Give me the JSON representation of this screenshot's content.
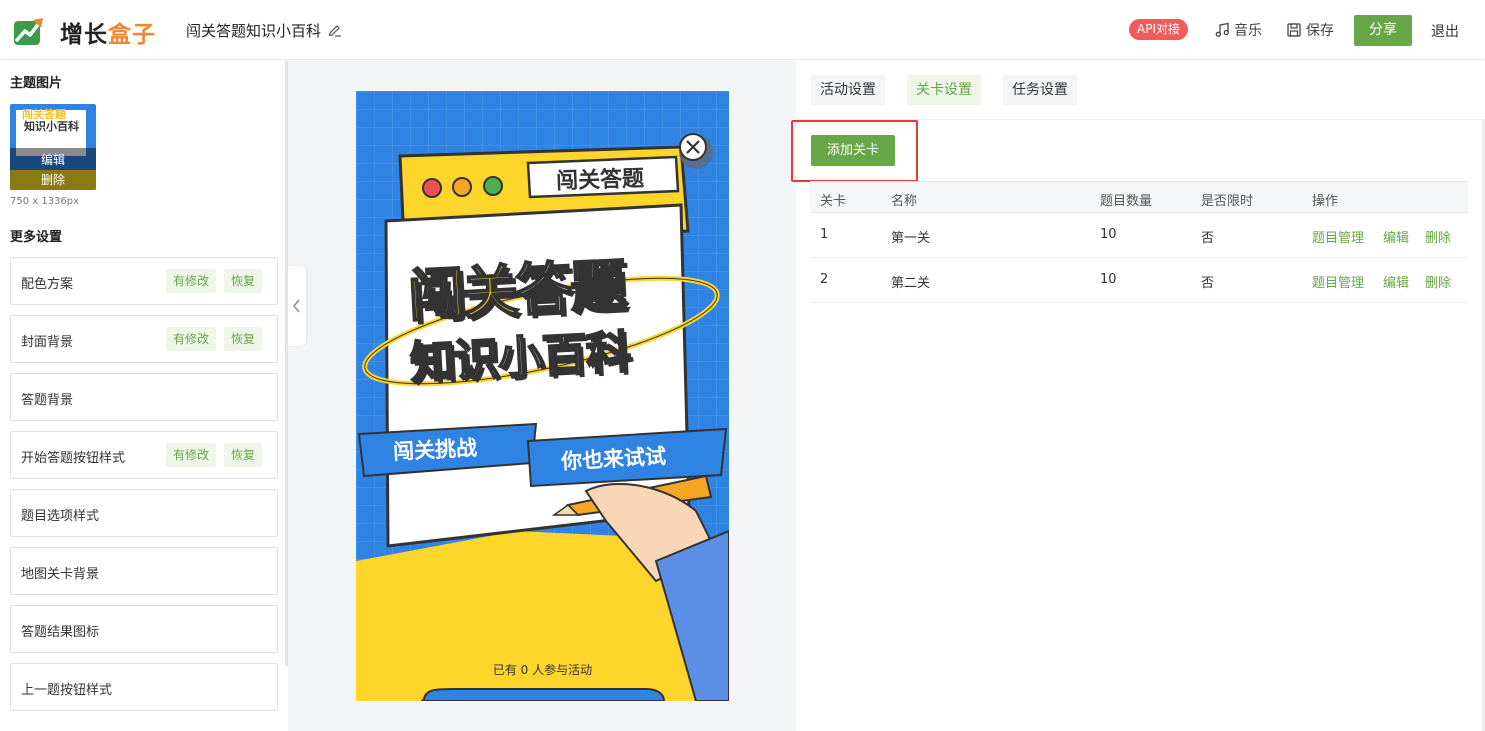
{
  "header": {
    "logo_part1": "增长",
    "logo_part2": "盒子",
    "doc_title": "闯关答题知识小百科",
    "api_badge": "API对接",
    "music_label": "音乐",
    "save_label": "保存",
    "share_label": "分享",
    "exit_label": "退出"
  },
  "left": {
    "theme_image_title": "主题图片",
    "thumb_text1": "闯关答题",
    "thumb_text2": "知识小百科",
    "thumb_edit": "编辑",
    "thumb_delete": "删除",
    "image_size": "750 x 1336px",
    "more_settings_title": "更多设置",
    "modified_tag": "有修改",
    "restore_tag": "恢复",
    "items": [
      {
        "label": "配色方案",
        "modified": true
      },
      {
        "label": "封面背景",
        "modified": true
      },
      {
        "label": "答题背景",
        "modified": false
      },
      {
        "label": "开始答题按钮样式",
        "modified": true
      },
      {
        "label": "题目选项样式",
        "modified": false
      },
      {
        "label": "地图关卡背景",
        "modified": false
      },
      {
        "label": "答题结果图标",
        "modified": false
      },
      {
        "label": "上一题按钮样式",
        "modified": false
      }
    ]
  },
  "preview": {
    "window_title": "闯关答题",
    "headline1_a": "闯关",
    "headline1_b": "答题",
    "headline2": "知识小百科",
    "ribbon_left": "闯关挑战",
    "ribbon_right": "你也来试试",
    "participants": "已有 0 人参与活动"
  },
  "right": {
    "tabs": [
      "活动设置",
      "关卡设置",
      "任务设置"
    ],
    "active_tab": "关卡设置",
    "add_level_button": "添加关卡",
    "columns": [
      "关卡",
      "名称",
      "题目数量",
      "是否限时",
      "操作"
    ],
    "rows": [
      {
        "level": "1",
        "name": "第一关",
        "count": "10",
        "timed": "否"
      },
      {
        "level": "2",
        "name": "第二关",
        "count": "10",
        "timed": "否"
      }
    ],
    "actions": {
      "manage": "题目管理",
      "edit": "编辑",
      "delete": "删除"
    }
  },
  "colors": {
    "accent_green": "#67a748",
    "api_red": "#f25b5b",
    "highlight_red": "#e23c3c",
    "poster_blue": "#2f84e3",
    "poster_yellow": "#fdd52b"
  },
  "icons": [
    "growth-logo-icon",
    "edit-pencil-icon",
    "music-note-icon",
    "save-disk-icon",
    "chevron-left-icon",
    "close-circle-icon"
  ]
}
